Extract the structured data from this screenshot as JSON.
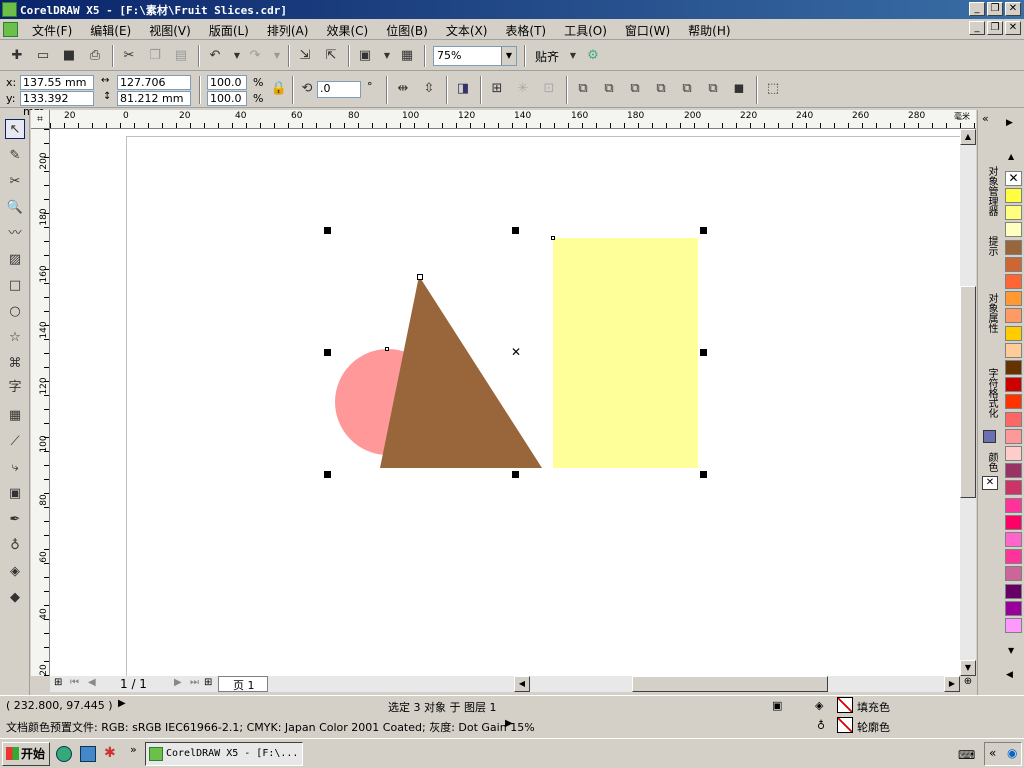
{
  "window": {
    "title": "CorelDRAW X5 - [F:\\素材\\Fruit Slices.cdr]",
    "caption_buttons": [
      "_",
      "❐",
      "✕"
    ]
  },
  "menubar": {
    "items": [
      "文件(F)",
      "编辑(E)",
      "视图(V)",
      "版面(L)",
      "排列(A)",
      "效果(C)",
      "位图(B)",
      "文本(X)",
      "表格(T)",
      "工具(O)",
      "窗口(W)",
      "帮助(H)"
    ]
  },
  "standard_toolbar": {
    "zoom_value": "75%",
    "snap_label": "贴齐",
    "icons": [
      "new-icon",
      "open-icon",
      "save-icon",
      "print-icon",
      "cut-icon",
      "copy-icon",
      "paste-icon",
      "undo-icon",
      "redo-icon",
      "import-icon",
      "export-icon",
      "launcher-icon",
      "welcome-icon",
      "options-icon"
    ]
  },
  "property_bar": {
    "x_label": "x:",
    "x_value": "137.55 mm",
    "y_label": "y:",
    "y_value": "133.392 mm",
    "w_value": "127.706 mm",
    "h_value": "81.212 mm",
    "scale_x": "100.0",
    "scale_y": "100.0",
    "pct": "%",
    "rotation": ".0",
    "deg": "°"
  },
  "rulers": {
    "h_ticks": [
      "20",
      "0",
      "20",
      "40",
      "60",
      "80",
      "100",
      "120",
      "140",
      "160",
      "180",
      "200",
      "220",
      "240",
      "260",
      "280"
    ],
    "h_unit": "毫米",
    "v_ticks": [
      "200",
      "180",
      "160",
      "140",
      "120",
      "100",
      "80",
      "60",
      "40",
      "20"
    ]
  },
  "page_nav": {
    "counter": "1 / 1",
    "tab": "页 1"
  },
  "dockers": {
    "tabs": [
      "对象管理器",
      "提示",
      "对象属性",
      "字符格式化",
      "颜色"
    ]
  },
  "palette": {
    "colors": [
      "#ffff40",
      "#ffff80",
      "#ffffc0",
      "#98663a",
      "#cc6633",
      "#ff6633",
      "#ff9933",
      "#ff9966",
      "#ffcc00",
      "#ffcc99",
      "#663300",
      "#cc0000",
      "#ff3300",
      "#ff6666",
      "#ff9999",
      "#ffcccc",
      "#993366",
      "#cc3366",
      "#ff3399",
      "#ff0066",
      "#ff66cc",
      "#ff3399",
      "#cc6699",
      "#660066",
      "#990099",
      "#ff99ff"
    ]
  },
  "shapes": {
    "circle_color": "#ff9999",
    "triangle_color": "#98663a",
    "rect_color": "#ffff99"
  },
  "status": {
    "coords": "( 232.800, 97.445 )",
    "selection": "选定 3 对象 于 图层 1",
    "profile": "文档颜色预置文件: RGB: sRGB IEC61966-2.1; CMYK: Japan Color 2001 Coated; 灰度: Dot Gain 15%",
    "fill_label": "填充色",
    "outline_label": "轮廓色"
  },
  "taskbar": {
    "start_label": "开始",
    "task_label": "CorelDRAW X5 - [F:\\..."
  }
}
